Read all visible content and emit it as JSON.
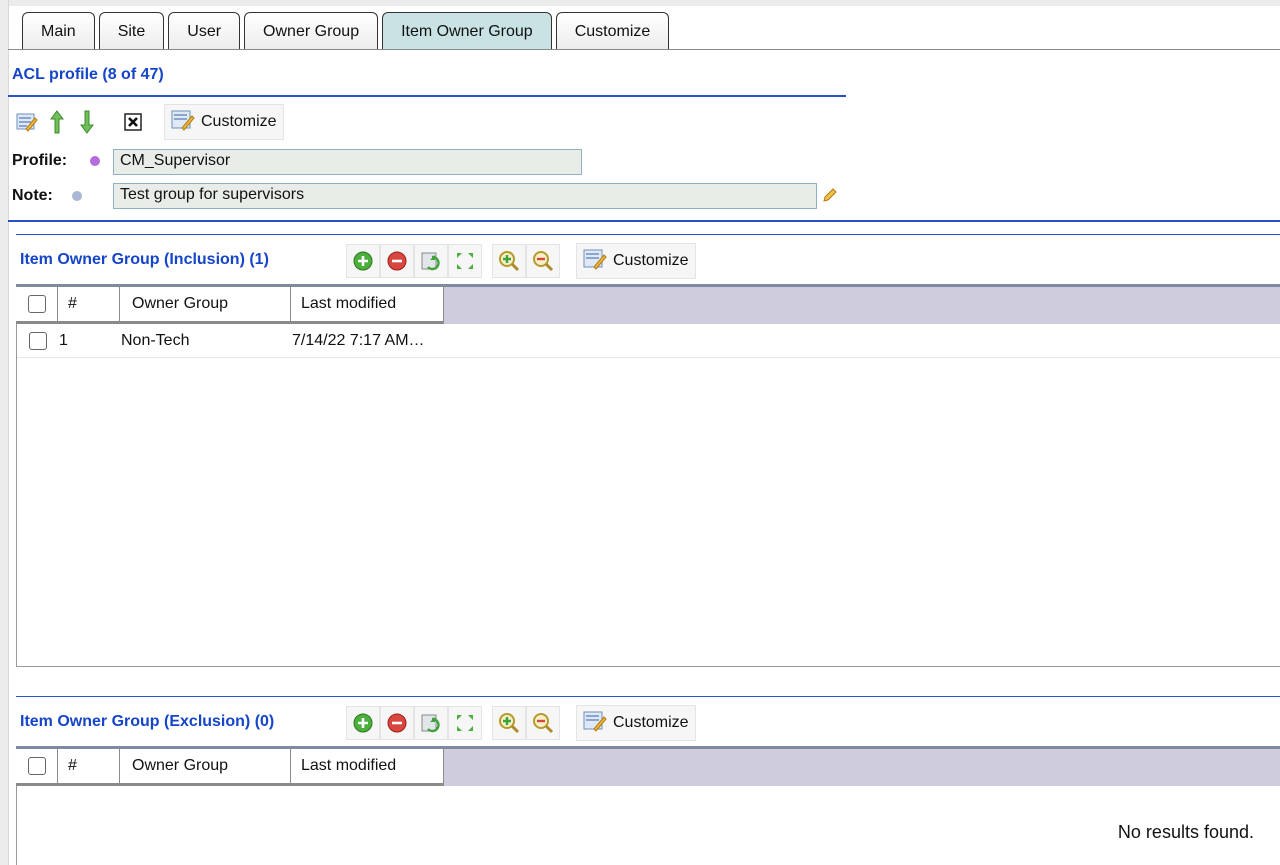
{
  "tabs": [
    {
      "label": "Main",
      "active": false
    },
    {
      "label": "Site",
      "active": false
    },
    {
      "label": "User",
      "active": false
    },
    {
      "label": "Owner Group",
      "active": false
    },
    {
      "label": "Item Owner Group",
      "active": true
    },
    {
      "label": "Customize",
      "active": false
    }
  ],
  "profile_section": {
    "title": "ACL profile (8 of 47)",
    "toolbar": {
      "icons": [
        "edit-list-icon",
        "arrow-up-icon",
        "arrow-down-icon",
        "delete-x-icon",
        "customize-icon"
      ],
      "customize_label": "Customize"
    },
    "profile_label": "Profile:",
    "profile_value": "CM_Supervisor",
    "note_label": "Note:",
    "note_value": "Test group for supervisors"
  },
  "inclusion": {
    "title": "Item Owner Group (Inclusion) (1)",
    "customize_label": "Customize",
    "columns": [
      "#",
      "Owner Group",
      "Last modified"
    ],
    "rows": [
      {
        "num": "1",
        "owner_group": "Non-Tech",
        "last_modified": "7/14/22 7:17 AM…"
      }
    ]
  },
  "exclusion": {
    "title": "Item Owner Group (Exclusion) (0)",
    "customize_label": "Customize",
    "columns": [
      "#",
      "Owner Group",
      "Last modified"
    ],
    "empty_message": "No results found."
  },
  "colors": {
    "title_blue": "#1545c8",
    "active_tab": "#c9e3e4",
    "grid_header_bg": "#cfcddd",
    "add_green": "#4caf3c",
    "remove_red": "#d9463e"
  }
}
